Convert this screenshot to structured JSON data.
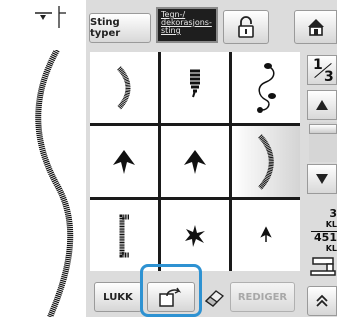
{
  "header": {
    "sting_typer_label": "Sting typer",
    "tegn_label": "Tegn-/\ndekorasjons-\nsting",
    "lock_icon": "lock-icon",
    "home_icon": "home-icon"
  },
  "preview": {
    "needle_icon": "needle-position-icon",
    "stitch_preview": "wavy-satin-stitch-preview"
  },
  "stitches": [
    {
      "icon": "satin-scallop-right-stitch-icon"
    },
    {
      "icon": "satin-block-stitch-icon"
    },
    {
      "icon": "swirl-leaf-stitch-icon"
    },
    {
      "icon": "leaf-up-stitch-icon"
    },
    {
      "icon": "leaf-up-stitch-icon"
    },
    {
      "icon": "satin-scallop-right-large-stitch-icon",
      "selected": true
    },
    {
      "icon": "bracket-left-stitch-icon"
    },
    {
      "icon": "star-stitch-icon"
    },
    {
      "icon": "small-leaf-stitch-icon"
    }
  ],
  "pager": {
    "current": "1",
    "total": "3"
  },
  "readout": {
    "value1": "3",
    "unit1": "KL",
    "value2": "451",
    "unit2": "KL"
  },
  "footer": {
    "lukk_label": "LUKK",
    "memory_icon": "memory-pocket-icon",
    "erase_icon": "eraser-icon",
    "rediger_label": "REDIGER",
    "expand_icon": "double-chevron-up-icon"
  },
  "colors": {
    "highlight": "#2e92d2",
    "panel": "#dcdcdc",
    "stitch": "#111111"
  }
}
